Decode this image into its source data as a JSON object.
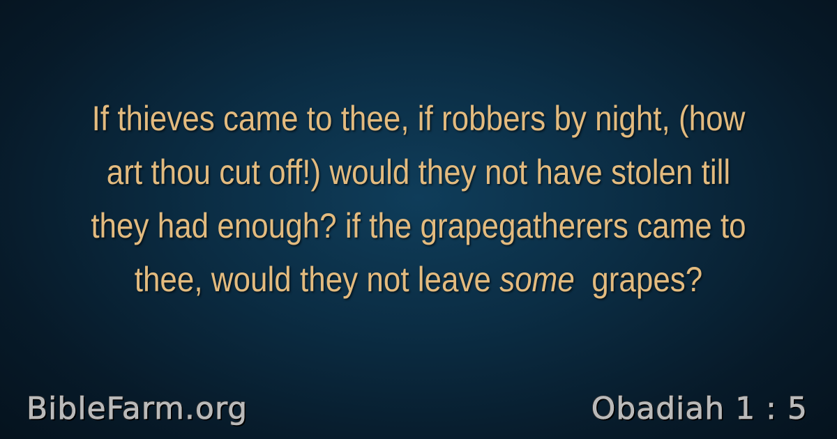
{
  "verse": {
    "text_before": "If thieves came to thee, if robbers by night, (how art thou cut off!) would they not have stolen till they had enough? if the grapegatherers came to thee, would they not leave ",
    "text_italic": "some",
    "text_after": " grapes?"
  },
  "footer": {
    "site": "BibleFarm.org",
    "reference": "Obadiah 1 : 5"
  },
  "colors": {
    "verse_text": "#e3bb7f",
    "footer_text": "#b9b9b9",
    "background_center": "#0f3d5a",
    "background_edge": "#04101a"
  }
}
